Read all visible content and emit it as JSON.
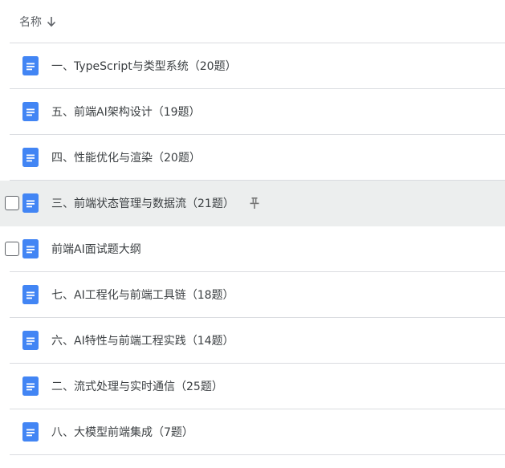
{
  "header": {
    "column_label": "名称",
    "sort_icon": "arrow-down-icon"
  },
  "files": [
    {
      "name": "一、TypeScript与类型系统（20题）",
      "icon": "google-doc-icon"
    },
    {
      "name": "五、前端AI架构设计（19题）",
      "icon": "google-doc-icon"
    },
    {
      "name": "四、性能优化与渲染（20题）",
      "icon": "google-doc-icon"
    },
    {
      "name": "三、前端状态管理与数据流（21题）",
      "icon": "google-doc-icon",
      "hovered": true,
      "pin_icon": "pin-icon"
    },
    {
      "name": "前端AI面试题大纲",
      "icon": "google-doc-icon"
    },
    {
      "name": "七、AI工程化与前端工具链（18题）",
      "icon": "google-doc-icon"
    },
    {
      "name": "六、AI特性与前端工程实践（14题）",
      "icon": "google-doc-icon"
    },
    {
      "name": "二、流式处理与实时通信（25题）",
      "icon": "google-doc-icon"
    },
    {
      "name": "八、大模型前端集成（7题）",
      "icon": "google-doc-icon"
    }
  ],
  "colors": {
    "doc_icon": "#4285f4",
    "hover_row": "#eceeee",
    "divider": "#dadce0"
  }
}
